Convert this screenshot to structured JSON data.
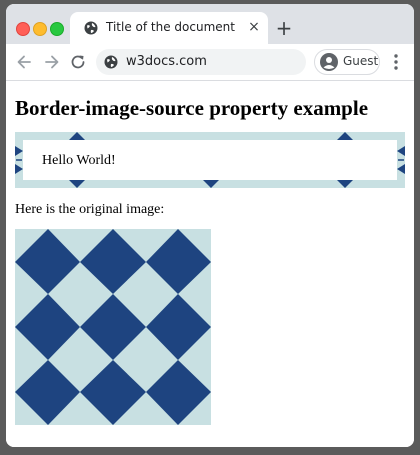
{
  "browser": {
    "tab_title": "Title of the document",
    "tab_close": "×",
    "new_tab": "+",
    "url": "w3docs.com",
    "profile_label": "Guest"
  },
  "page": {
    "heading": "Border-image-source property example",
    "demo_text": "Hello World!",
    "caption": "Here is the original image:"
  },
  "colors": {
    "pattern_light": "#c8e0e2",
    "pattern_dark": "#1e4480",
    "tab_strip": "#dee1e6",
    "omnibox": "#f1f3f4"
  },
  "icons": {
    "tab_favicon": "globe-icon",
    "back": "arrow-left-icon",
    "forward": "arrow-right-icon",
    "reload": "reload-icon",
    "site_info": "globe-icon",
    "profile": "avatar-icon",
    "menu": "kebab-menu-icon"
  }
}
